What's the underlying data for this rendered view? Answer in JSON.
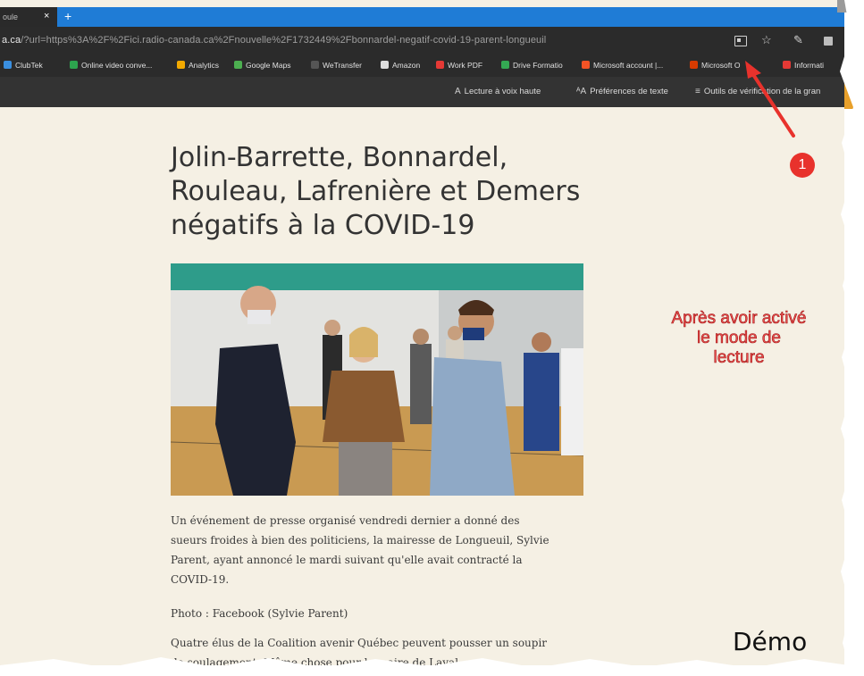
{
  "tab": {
    "title": "oule",
    "close": "×",
    "new": "+"
  },
  "address_bar": {
    "host": "a.ca",
    "rest": "/?url=https%3A%2F%2Fici.radio-canada.ca%2Fnouvelle%2F1732449%2Fbonnardel-negatif-covid-19-parent-longueuil"
  },
  "toolbar_icons": {
    "reader_view": "reader-view-icon",
    "favorite": "☆",
    "favorite_icon": "star-icon",
    "pen": "✎",
    "pen_icon": "pen-icon"
  },
  "bookmarks": [
    {
      "label": "ClubTek",
      "color": "#3a8fe0"
    },
    {
      "label": "Online video conve...",
      "color": "#2da44e"
    },
    {
      "label": "Analytics",
      "color": "#f2a900"
    },
    {
      "label": "Google Maps",
      "color": "#4caf50"
    },
    {
      "label": "WeTransfer",
      "color": "#222222"
    },
    {
      "label": "Amazon",
      "color": "#dddddd"
    },
    {
      "label": "Work PDF",
      "color": "#e53935"
    },
    {
      "label": "Drive Formatio",
      "color": "#34a853"
    },
    {
      "label": "Microsoft account |...",
      "color": "#f35325"
    },
    {
      "label": "Microsoft O",
      "color": "#d83b01"
    },
    {
      "label": "Informati",
      "color": "#e53935"
    }
  ],
  "reader_toolbar": {
    "read_aloud": "Lecture à voix haute",
    "read_aloud_symbol": "A",
    "text_prefs": "Préférences de texte",
    "text_prefs_symbol": "ᴬA",
    "grammar_tools": "Outils de vérification de la gran",
    "grammar_symbol": "≡"
  },
  "article": {
    "title_lines": [
      "Jolin-Barrette, Bonnardel,",
      "Rouleau, Lafrenière et Demers",
      "négatifs à la COVID-19"
    ],
    "paragraph1_lines": [
      "Un événement de presse organisé vendredi dernier a donné des",
      "sueurs froides à bien des politiciens, la mairesse de Longueuil, Sylvie",
      "Parent, ayant annoncé le mardi suivant qu'elle avait contracté la",
      "COVID-19."
    ],
    "caption": "Photo : Facebook (Sylvie Parent)",
    "paragraph2_lines": [
      "Quatre élus de la Coalition avenir Québec peuvent pousser un soupir",
      "de soulagement. Même chose pour le maire de Laval."
    ]
  },
  "annotation": {
    "lines": [
      "Après avoir activé",
      "le mode de",
      "lecture"
    ],
    "badge": "1",
    "color": "#e8322c"
  },
  "demo_label": "Démo",
  "colors": {
    "tab_bar": "#1f7cd6",
    "toolbar": "#2b2b2b",
    "reader_bar": "#333333",
    "page_bg": "#f5f0e4",
    "accent_orange": "#e8a02a"
  }
}
